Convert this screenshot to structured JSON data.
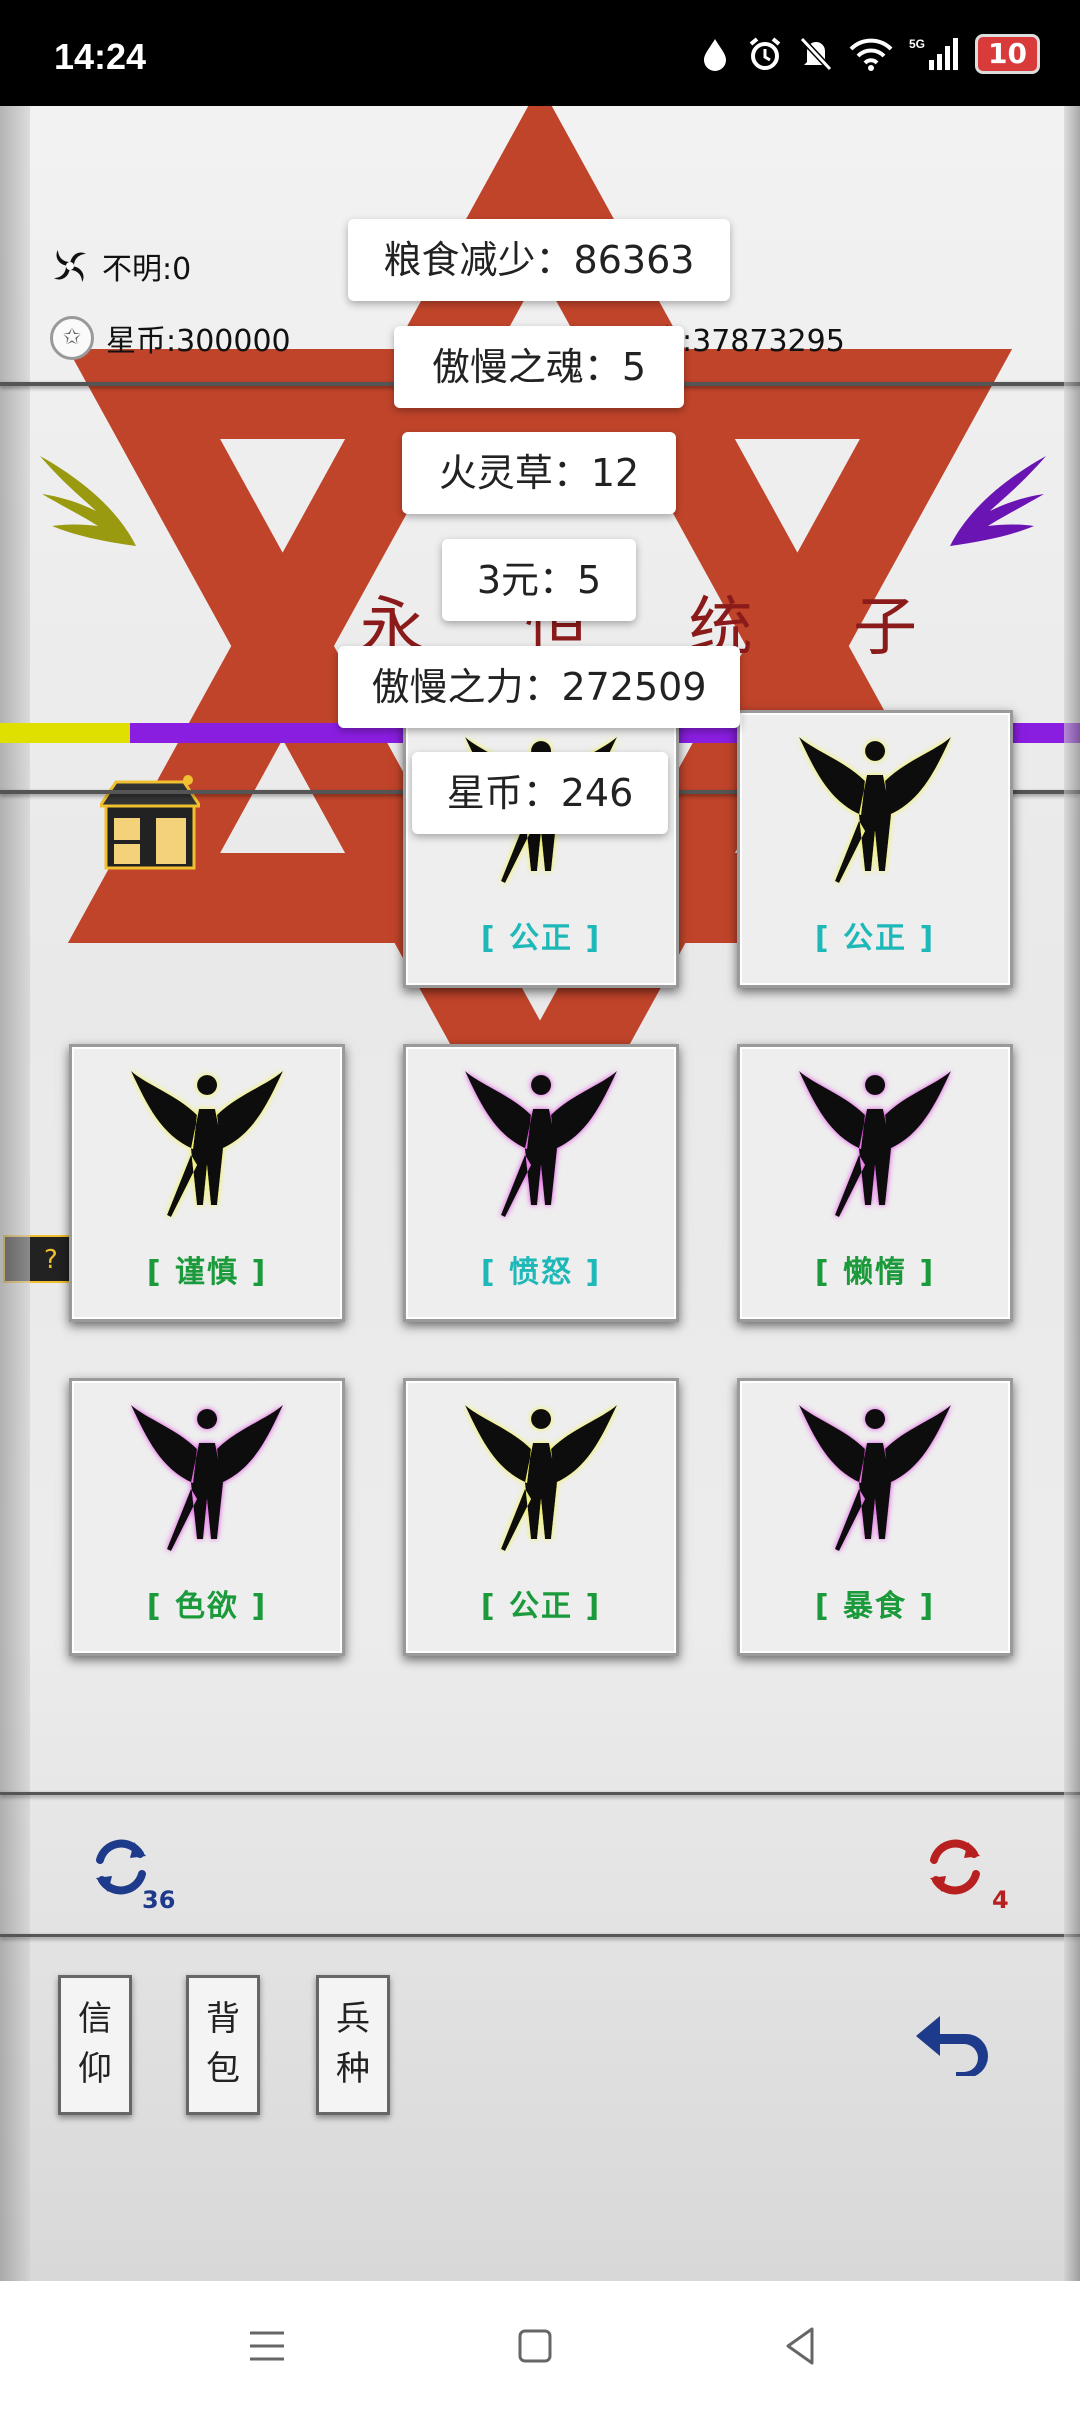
{
  "status_bar": {
    "time": "14:24",
    "battery": "10",
    "icons": [
      "droplet-icon",
      "alarm-icon",
      "bell-off-icon",
      "wifi-icon",
      "signal-5g-icon"
    ]
  },
  "resources": {
    "unknown_label": "不明:0",
    "star_coin_label": "星币:300000",
    "food_label": "食:37873295",
    "hidden_value": "0"
  },
  "title": "永 恒 统 子",
  "cards": [
    {
      "label": "[ 公正 ]",
      "color": "#1fb8b8",
      "glow": "#f2f24a"
    },
    {
      "label": "[ 公正 ]",
      "color": "#1fb8b8",
      "glow": "#f2f24a"
    },
    {
      "label": "[ 谨慎 ]",
      "color": "#1a9a3a",
      "glow": "#f2f24a"
    },
    {
      "label": "[ 愤怒 ]",
      "color": "#1fb8b8",
      "glow": "#e04ae0"
    },
    {
      "label": "[ 懒惰 ]",
      "color": "#1a9a3a",
      "glow": "#e04ae0"
    },
    {
      "label": "[ 色欲 ]",
      "color": "#1a9a3a",
      "glow": "#e04ae0"
    },
    {
      "label": "[ 公正 ]",
      "color": "#1a9a3a",
      "glow": "#f2f24a"
    },
    {
      "label": "[ 暴食 ]",
      "color": "#1a9a3a",
      "glow": "#e04ae0"
    }
  ],
  "refresh": {
    "left_count": "36",
    "right_count": "4"
  },
  "side_buttons": {
    "faith": "信\n仰",
    "bag": "背\n包",
    "troops": "兵\n种"
  },
  "toasts": [
    "粮食减少：86363",
    "傲慢之魂：5",
    "火灵草：12",
    "3元：5",
    "傲慢之力：272509",
    "星币：246"
  ],
  "colors": {
    "accent_purple": "#8a1ee0",
    "accent_yellow": "#e0e000",
    "title_red": "#8b1a1a"
  }
}
